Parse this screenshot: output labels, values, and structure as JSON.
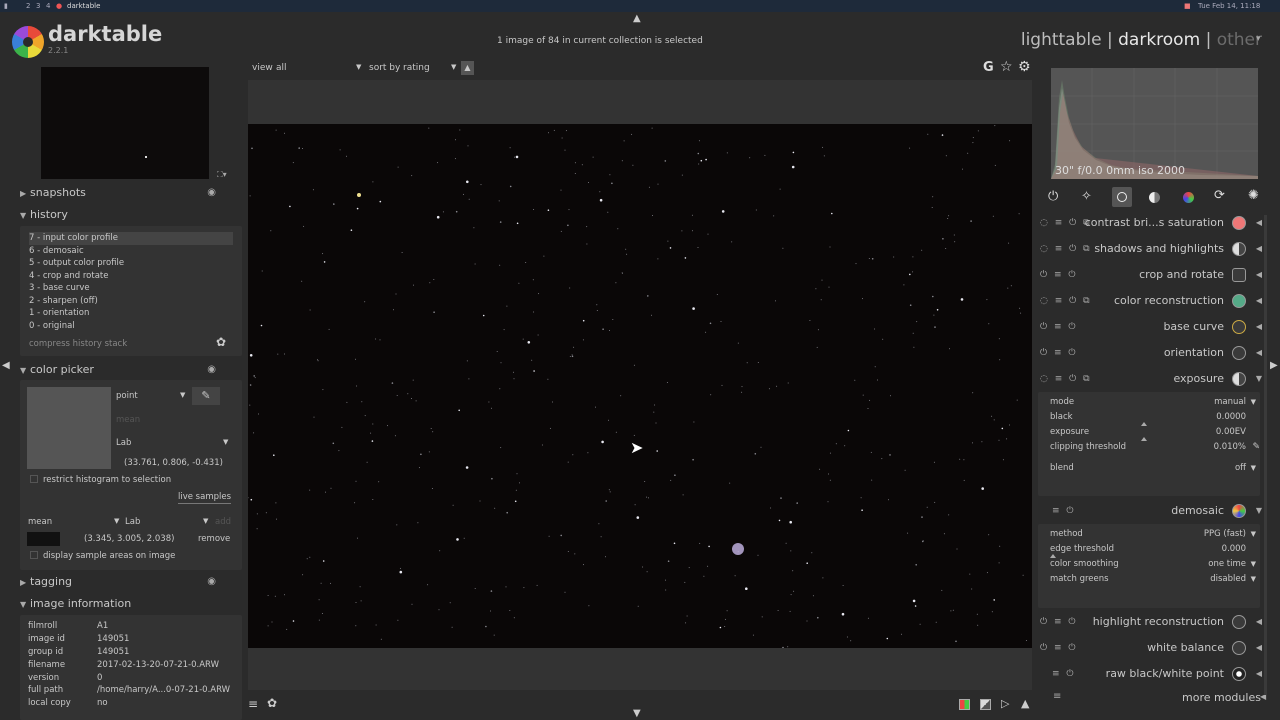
{
  "taskbar": {
    "workspaces": [
      "2",
      "3",
      "4"
    ],
    "app_label": "darktable",
    "clock": "Tue Feb 14, 11:18"
  },
  "app": {
    "name": "darktable",
    "version": "2.2.1"
  },
  "header": {
    "status": "1 image of 84 in current collection is selected",
    "views": {
      "lighttable": "lighttable",
      "separator1": "|",
      "darkroom": "darkroom",
      "separator2": "|",
      "other": "other"
    }
  },
  "topbar": {
    "view_label": "view",
    "view_value": "all",
    "sort_label": "sort by",
    "sort_value": "rating",
    "g_label": "G"
  },
  "left": {
    "snapshots": "snapshots",
    "history": "history",
    "history_items": [
      "7 - input color profile",
      "6 - demosaic",
      "5 - output color profile",
      "4 - crop and rotate",
      "3 - base curve",
      "2 - sharpen (off)",
      "1 - orientation",
      "0 - original"
    ],
    "compress": "compress history stack",
    "color_picker": "color picker",
    "picker_mode": "point",
    "picker_stat": "mean",
    "picker_space": "Lab",
    "picker_value": "(33.761, 0.806, -0.431)",
    "restrict": "restrict histogram to selection",
    "live_samples": "live samples",
    "sample_stat": "mean",
    "sample_space": "Lab",
    "add": "add",
    "sample_value": "(3.345, 3.005, 2.038)",
    "remove": "remove",
    "display_areas": "display sample areas on image",
    "tagging": "tagging",
    "image_information": "image information",
    "info": [
      {
        "k": "filmroll",
        "v": "A1"
      },
      {
        "k": "image id",
        "v": "149051"
      },
      {
        "k": "group id",
        "v": "149051"
      },
      {
        "k": "filename",
        "v": "2017-02-13-20-07-21-0.ARW"
      },
      {
        "k": "version",
        "v": "0"
      },
      {
        "k": "full path",
        "v": "/home/harry/A...0-07-21-0.ARW"
      },
      {
        "k": "local copy",
        "v": "no"
      }
    ]
  },
  "right": {
    "histogram_info": "30\" f/0.0 0mm iso 2000",
    "modules": [
      "contrast bri...s saturation",
      "shadows and highlights",
      "crop and rotate",
      "color reconstruction",
      "base curve",
      "orientation",
      "exposure"
    ],
    "exposure_params": [
      {
        "k": "mode",
        "v": "manual",
        "dd": true
      },
      {
        "k": "black",
        "v": "0.0000",
        "dd": false
      },
      {
        "k": "exposure",
        "v": "0.00EV",
        "dd": false
      },
      {
        "k": "clipping threshold",
        "v": "0.010%",
        "dd": false
      },
      {
        "k": "blend",
        "v": "off",
        "dd": true
      }
    ],
    "demosaic": "demosaic",
    "demosaic_params": [
      {
        "k": "method",
        "v": "PPG (fast)",
        "dd": true
      },
      {
        "k": "edge threshold",
        "v": "0.000",
        "dd": false
      },
      {
        "k": "color smoothing",
        "v": "one time",
        "dd": true
      },
      {
        "k": "match greens",
        "v": "disabled",
        "dd": true
      }
    ],
    "modules_bottom": [
      "highlight reconstruction",
      "white balance",
      "raw black/white point"
    ],
    "more_modules": "more modules"
  },
  "colors": {
    "bg": "#2b2b2b",
    "panel": "#333333",
    "image_bg": "#0a0707"
  }
}
